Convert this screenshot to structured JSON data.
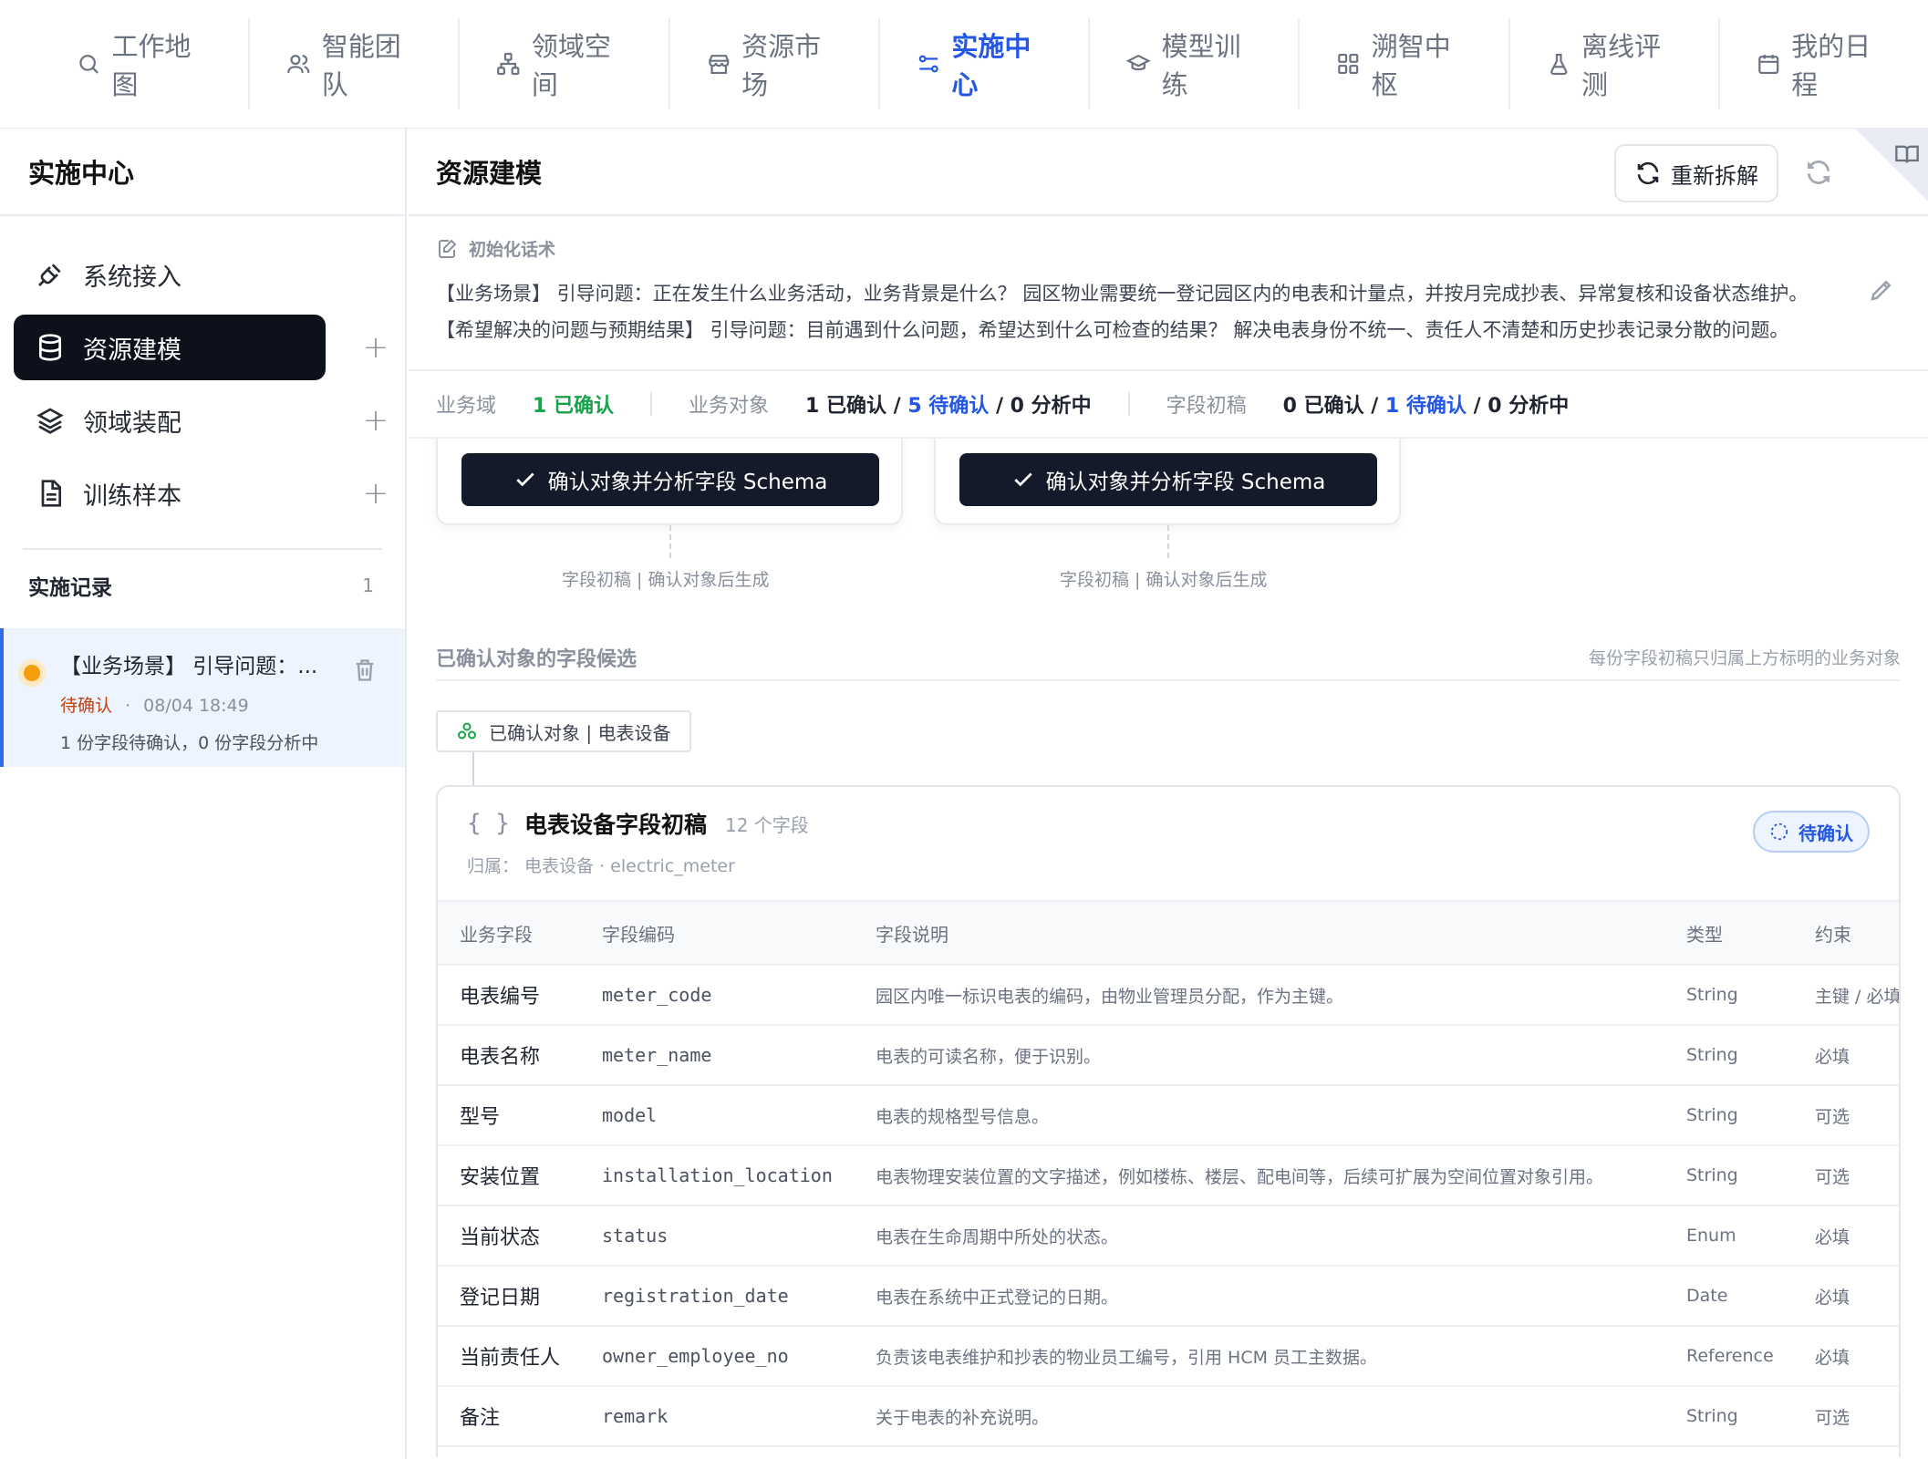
{
  "topnav": {
    "tabs": [
      {
        "label": "工作地图",
        "icon": "search-icon",
        "active": false
      },
      {
        "label": "智能团队",
        "icon": "users-icon",
        "active": false
      },
      {
        "label": "领域空间",
        "icon": "hierarchy-icon",
        "active": false
      },
      {
        "label": "资源市场",
        "icon": "store-icon",
        "active": false
      },
      {
        "label": "实施中心",
        "icon": "sliders-icon",
        "active": true
      },
      {
        "label": "模型训练",
        "icon": "graduation-cap-icon",
        "active": false
      },
      {
        "label": "溯智中枢",
        "icon": "grid-icon",
        "active": false
      },
      {
        "label": "离线评测",
        "icon": "flask-icon",
        "active": false
      },
      {
        "label": "我的日程",
        "icon": "calendar-icon",
        "active": false
      }
    ]
  },
  "sidebar": {
    "title": "实施中心",
    "items": [
      {
        "label": "系统接入",
        "icon": "plug-icon"
      },
      {
        "label": "资源建模",
        "icon": "database-icon"
      },
      {
        "label": "领域装配",
        "icon": "layers-icon"
      },
      {
        "label": "训练样本",
        "icon": "document-icon"
      }
    ],
    "plus": "+",
    "records_title": "实施记录",
    "records_count": "1",
    "record": {
      "title": "【业务场景】 引导问题：...",
      "status": "待确认",
      "sep": "·",
      "time": "08/04 18:49",
      "desc": "1 份字段待确认，0 份字段分析中"
    }
  },
  "main": {
    "title": "资源建模",
    "redo_button": "重新拆解",
    "init_label": "初始化话术",
    "init_text": "【业务场景】 引导问题：正在发生什么业务活动，业务背景是什么？ 园区物业需要统一登记园区内的电表和计量点，并按月完成抄表、异常复核和设备状态维护。 【希望解决的问题与预期结果】 引导问题：目前遇到什么问题，希望达到什么可检查的结果？ 解决电表身份不统一、责任人不清楚和历史抄表记录分散的问题。",
    "stats": {
      "domain_label": "业务域",
      "domain_confirmed": "1 已确认",
      "object_label": "业务对象",
      "object_confirmed": "1 已确认 / ",
      "object_pending": "5 待确认",
      "object_analyzing": " / 0 分析中",
      "field_label": "字段初稿",
      "field_confirmed": "0 已确认 / ",
      "field_pending": "1 待确认",
      "field_analyzing": " / 0 分析中"
    },
    "confirm_button": "确认对象并分析字段 Schema",
    "card_caption": "字段初稿 | 确认对象后生成",
    "section_title": "已确认对象的字段候选",
    "section_note": "每份字段初稿只归属上方标明的业务对象",
    "chip": "已确认对象 | 电表设备",
    "draft": {
      "braces": "{ }",
      "title": "电表设备字段初稿",
      "count": "12 个字段",
      "belong": "归属：  电表设备 · electric_meter",
      "badge": "待确认",
      "columns": [
        "业务字段",
        "字段编码",
        "字段说明",
        "类型",
        "约束"
      ],
      "rows": [
        {
          "field": "电表编号",
          "code": "meter_code",
          "desc": "园区内唯一标识电表的编码，由物业管理员分配，作为主键。",
          "type": "String",
          "constraint": "主键 / 必填"
        },
        {
          "field": "电表名称",
          "code": "meter_name",
          "desc": "电表的可读名称，便于识别。",
          "type": "String",
          "constraint": "必填"
        },
        {
          "field": "型号",
          "code": "model",
          "desc": "电表的规格型号信息。",
          "type": "String",
          "constraint": "可选"
        },
        {
          "field": "安装位置",
          "code": "installation_location",
          "desc": "电表物理安装位置的文字描述，例如楼栋、楼层、配电间等，后续可扩展为空间位置对象引用。",
          "type": "String",
          "constraint": "可选"
        },
        {
          "field": "当前状态",
          "code": "status",
          "desc": "电表在生命周期中所处的状态。",
          "type": "Enum",
          "constraint": "必填"
        },
        {
          "field": "登记日期",
          "code": "registration_date",
          "desc": "电表在系统中正式登记的日期。",
          "type": "Date",
          "constraint": "必填"
        },
        {
          "field": "当前责任人",
          "code": "owner_employee_no",
          "desc": "负责该电表维护和抄表的物业员工编号，引用 HCM 员工主数据。",
          "type": "Reference",
          "constraint": "必填"
        },
        {
          "field": "备注",
          "code": "remark",
          "desc": "关于电表的补充说明。",
          "type": "String",
          "constraint": "可选"
        }
      ]
    }
  },
  "colors": {
    "accent": "#2457e6",
    "dark": "#0d111c",
    "success": "#16a34a",
    "pending": "#c2410c"
  }
}
